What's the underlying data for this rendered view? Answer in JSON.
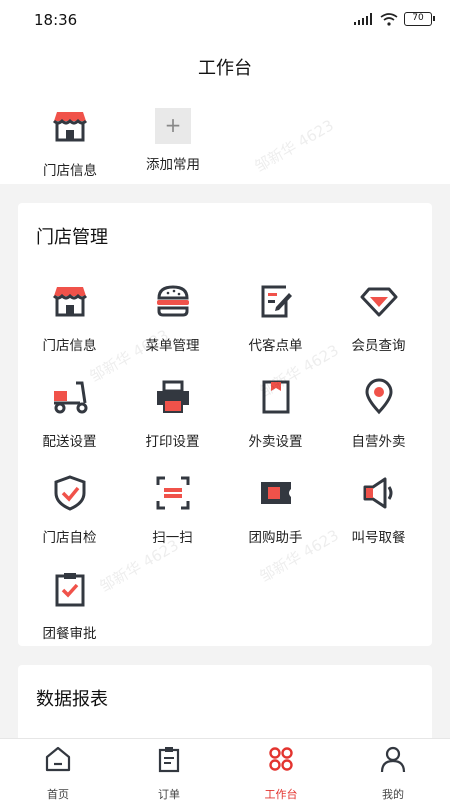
{
  "status_bar": {
    "time": "18:36",
    "battery": "70"
  },
  "header": {
    "title": "工作台"
  },
  "quick_access": [
    {
      "label": "门店信息",
      "icon": "store-icon"
    },
    {
      "label": "添加常用",
      "icon": "plus-icon"
    }
  ],
  "store_management": {
    "title": "门店管理",
    "items": [
      {
        "label": "门店信息",
        "icon": "store-icon"
      },
      {
        "label": "菜单管理",
        "icon": "burger-icon"
      },
      {
        "label": "代客点单",
        "icon": "edit-order-icon"
      },
      {
        "label": "会员查询",
        "icon": "diamond-icon"
      },
      {
        "label": "配送设置",
        "icon": "scooter-icon"
      },
      {
        "label": "打印设置",
        "icon": "printer-icon"
      },
      {
        "label": "外卖设置",
        "icon": "takeout-bag-icon"
      },
      {
        "label": "自营外卖",
        "icon": "location-pin-icon"
      },
      {
        "label": "门店自检",
        "icon": "shield-check-icon"
      },
      {
        "label": "扫一扫",
        "icon": "scan-icon"
      },
      {
        "label": "团购助手",
        "icon": "ticket-icon"
      },
      {
        "label": "叫号取餐",
        "icon": "speaker-icon"
      },
      {
        "label": "团餐审批",
        "icon": "clipboard-check-icon"
      }
    ]
  },
  "data_reports": {
    "title": "数据报表"
  },
  "watermark": "邹新华 4623",
  "tab_bar": [
    {
      "label": "首页",
      "icon": "home-icon",
      "active": false
    },
    {
      "label": "订单",
      "icon": "order-icon",
      "active": false
    },
    {
      "label": "工作台",
      "icon": "workbench-icon",
      "active": true
    },
    {
      "label": "我的",
      "icon": "profile-icon",
      "active": false
    }
  ],
  "colors": {
    "accent": "#e3342f",
    "icon_dark": "#333840",
    "icon_red": "#f0524a"
  }
}
